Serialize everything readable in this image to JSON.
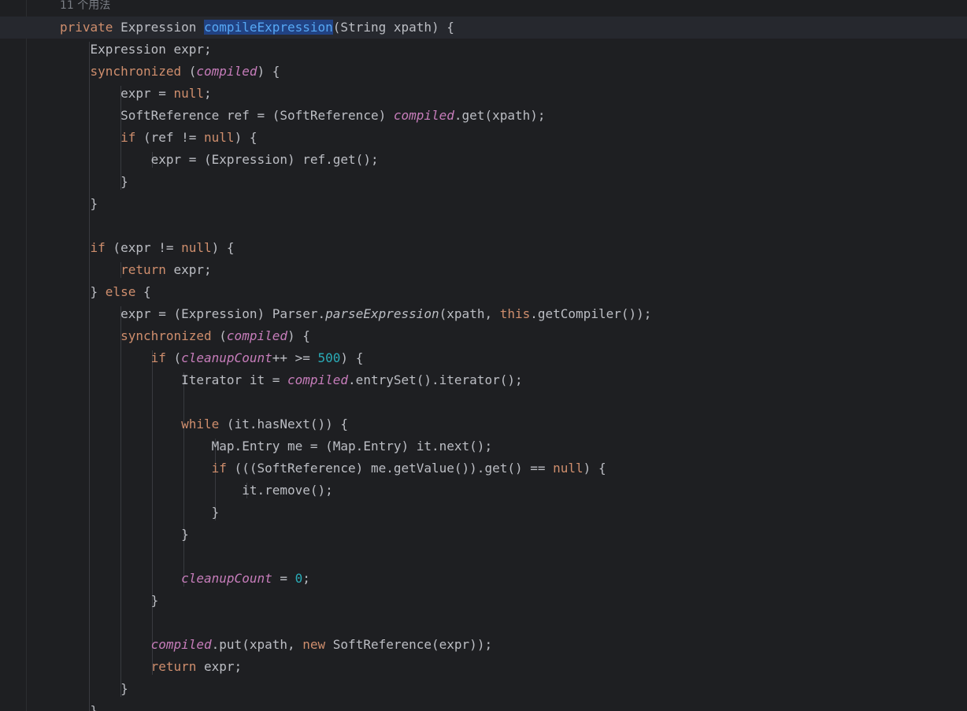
{
  "editor": {
    "inlay_hint": "11 个用法",
    "colors": {
      "background": "#1e1f22",
      "current_line": "#26282e",
      "default_text": "#bcbec4",
      "keyword": "#cf8e6d",
      "field": "#c77dbb",
      "number": "#2aacb8",
      "method_declaration": "#56a8f5",
      "method_highlight": "#214283",
      "inlay_hint": "#7a7e85",
      "indent_guide": "#393b40"
    },
    "lines": [
      [
        [
          "kw",
          "private"
        ],
        [
          "p",
          " Expression "
        ],
        [
          "decl",
          "compileExpression"
        ],
        [
          "p",
          "(String xpath) {"
        ]
      ],
      [
        [
          "p",
          "    Expression expr;"
        ]
      ],
      [
        [
          "p",
          "    "
        ],
        [
          "kw",
          "synchronized"
        ],
        [
          "p",
          " ("
        ],
        [
          "field",
          "compiled"
        ],
        [
          "p",
          ") {"
        ]
      ],
      [
        [
          "p",
          "        expr = "
        ],
        [
          "kw",
          "null"
        ],
        [
          "p",
          ";"
        ]
      ],
      [
        [
          "p",
          "        SoftReference ref = (SoftReference) "
        ],
        [
          "field",
          "compiled"
        ],
        [
          "p",
          ".get(xpath);"
        ]
      ],
      [
        [
          "p",
          "        "
        ],
        [
          "kw",
          "if"
        ],
        [
          "p",
          " (ref != "
        ],
        [
          "kw",
          "null"
        ],
        [
          "p",
          ") {"
        ]
      ],
      [
        [
          "p",
          "            expr = (Expression) ref.get();"
        ]
      ],
      [
        [
          "p",
          "        }"
        ]
      ],
      [
        [
          "p",
          "    }"
        ]
      ],
      [],
      [
        [
          "p",
          "    "
        ],
        [
          "kw",
          "if"
        ],
        [
          "p",
          " (expr != "
        ],
        [
          "kw",
          "null"
        ],
        [
          "p",
          ") {"
        ]
      ],
      [
        [
          "p",
          "        "
        ],
        [
          "kw",
          "return"
        ],
        [
          "p",
          " expr;"
        ]
      ],
      [
        [
          "p",
          "    } "
        ],
        [
          "kw",
          "else"
        ],
        [
          "p",
          " {"
        ]
      ],
      [
        [
          "p",
          "        expr = (Expression) Parser."
        ],
        [
          "static",
          "parseExpression"
        ],
        [
          "p",
          "(xpath, "
        ],
        [
          "kw",
          "this"
        ],
        [
          "p",
          ".getCompiler());"
        ]
      ],
      [
        [
          "p",
          "        "
        ],
        [
          "kw",
          "synchronized"
        ],
        [
          "p",
          " ("
        ],
        [
          "field",
          "compiled"
        ],
        [
          "p",
          ") {"
        ]
      ],
      [
        [
          "p",
          "            "
        ],
        [
          "kw",
          "if"
        ],
        [
          "p",
          " ("
        ],
        [
          "field",
          "cleanupCount"
        ],
        [
          "p",
          "++ >= "
        ],
        [
          "num",
          "500"
        ],
        [
          "p",
          ") {"
        ]
      ],
      [
        [
          "p",
          "                Iterator it = "
        ],
        [
          "field",
          "compiled"
        ],
        [
          "p",
          ".entrySet().iterator();"
        ]
      ],
      [],
      [
        [
          "p",
          "                "
        ],
        [
          "kw",
          "while"
        ],
        [
          "p",
          " (it.hasNext()) {"
        ]
      ],
      [
        [
          "p",
          "                    Map.Entry me = (Map.Entry) it.next();"
        ]
      ],
      [
        [
          "p",
          "                    "
        ],
        [
          "kw",
          "if"
        ],
        [
          "p",
          " (((SoftReference) me.getValue()).get() == "
        ],
        [
          "kw",
          "null"
        ],
        [
          "p",
          ") {"
        ]
      ],
      [
        [
          "p",
          "                        it.remove();"
        ]
      ],
      [
        [
          "p",
          "                    }"
        ]
      ],
      [
        [
          "p",
          "                }"
        ]
      ],
      [],
      [
        [
          "p",
          "                "
        ],
        [
          "field",
          "cleanupCount"
        ],
        [
          "p",
          " = "
        ],
        [
          "num",
          "0"
        ],
        [
          "p",
          ";"
        ]
      ],
      [
        [
          "p",
          "            }"
        ]
      ],
      [],
      [
        [
          "p",
          "            "
        ],
        [
          "field",
          "compiled"
        ],
        [
          "p",
          ".put(xpath, "
        ],
        [
          "kw",
          "new"
        ],
        [
          "p",
          " SoftReference(expr));"
        ]
      ],
      [
        [
          "p",
          "            "
        ],
        [
          "kw",
          "return"
        ],
        [
          "p",
          " expr;"
        ]
      ],
      [
        [
          "p",
          "        }"
        ]
      ],
      [
        [
          "p",
          "    }"
        ]
      ]
    ]
  }
}
